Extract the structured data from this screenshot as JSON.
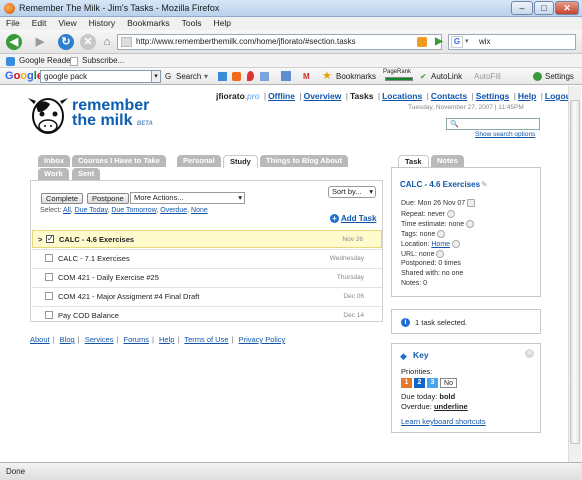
{
  "window": {
    "title": "Remember The Milk - Jim's Tasks - Mozilla Firefox"
  },
  "menu": [
    "File",
    "Edit",
    "View",
    "History",
    "Bookmarks",
    "Tools",
    "Help"
  ],
  "nav": {
    "url": "http://www.rememberthemilk.com/home/jfiorato/#section.tasks",
    "search_value": "wix"
  },
  "bookmarks": [
    "Google Reader",
    "Subscribe..."
  ],
  "google_toolbar": {
    "input": "google pack",
    "search_label": "Search",
    "bookmarks_label": "Bookmarks",
    "pagerank_label": "PageRank",
    "autolink_label": "AutoLink",
    "autofill_label": "AutoFill",
    "settings_label": "Settings"
  },
  "brand": {
    "line1": "remember",
    "line2": "the milk",
    "beta": "BETA"
  },
  "topnav": {
    "user": "jfiorato",
    "pro": ".pro",
    "links": [
      "Offline",
      "Overview",
      "Tasks",
      "Locations",
      "Contacts",
      "Settings",
      "Help",
      "Logout"
    ],
    "date": "Tuesday, November 27, 2007 | 11:45PM",
    "show_search": "Show search options"
  },
  "tabs": {
    "row1": [
      "Inbox",
      "Courses I Have to Take",
      "Personal",
      "Study",
      "Things to Blog About"
    ],
    "row2": [
      "Work",
      "Sent"
    ]
  },
  "toolbar": {
    "complete": "Complete",
    "postpone": "Postpone",
    "more_actions": "More Actions...",
    "sort": "Sort by..."
  },
  "select": {
    "label": "Select:",
    "options": [
      "All",
      "Due Today",
      "Due Tomorrow",
      "Overdue",
      "None"
    ]
  },
  "add_task": "Add Task",
  "tasks": [
    {
      "name": "CALC - 4.6 Exercises",
      "due": "Nov 26",
      "marker": ">"
    },
    {
      "name": "CALC - 7.1 Exercises",
      "due": "Wednesday",
      "marker": ""
    },
    {
      "name": "COM 421 - Daily Exercise #25",
      "due": "Thursday",
      "marker": ""
    },
    {
      "name": "COM 421 - Major Assigment #4 Final Draft",
      "due": "Dec 06",
      "marker": ""
    },
    {
      "name": "Pay COD Balance",
      "due": "Dec 14",
      "marker": ""
    }
  ],
  "footer": [
    "About",
    "Blog",
    "Services",
    "Forums",
    "Help",
    "Terms of Use",
    "Privacy Policy"
  ],
  "task_panel": {
    "tab_task": "Task",
    "tab_notes": "Notes",
    "title": "CALC - 4.6 Exercises",
    "due": "Due: Mon 26 Nov 07",
    "repeat": "Repeat: never",
    "time_estimate": "Time estimate: none",
    "tags": "Tags: none",
    "location_label": "Location:",
    "location_value": "Home",
    "url": "URL: none",
    "postponed": "Postponed: 0 times",
    "shared": "Shared with: no one",
    "notes": "Notes: 0"
  },
  "selection": "1 task selected.",
  "key": {
    "title": "Key",
    "priorities_label": "Priorities:",
    "priorities": [
      "1",
      "2",
      "3",
      "No"
    ],
    "priority_colors": [
      "#e8762d",
      "#0f64c8",
      "#4aa3ef",
      "#ffffff"
    ],
    "due_today_label": "Due today:",
    "due_today_value": "bold",
    "overdue_label": "Overdue:",
    "overdue_value": "underline",
    "shortcuts": "Learn keyboard shortcuts"
  },
  "status": "Done"
}
